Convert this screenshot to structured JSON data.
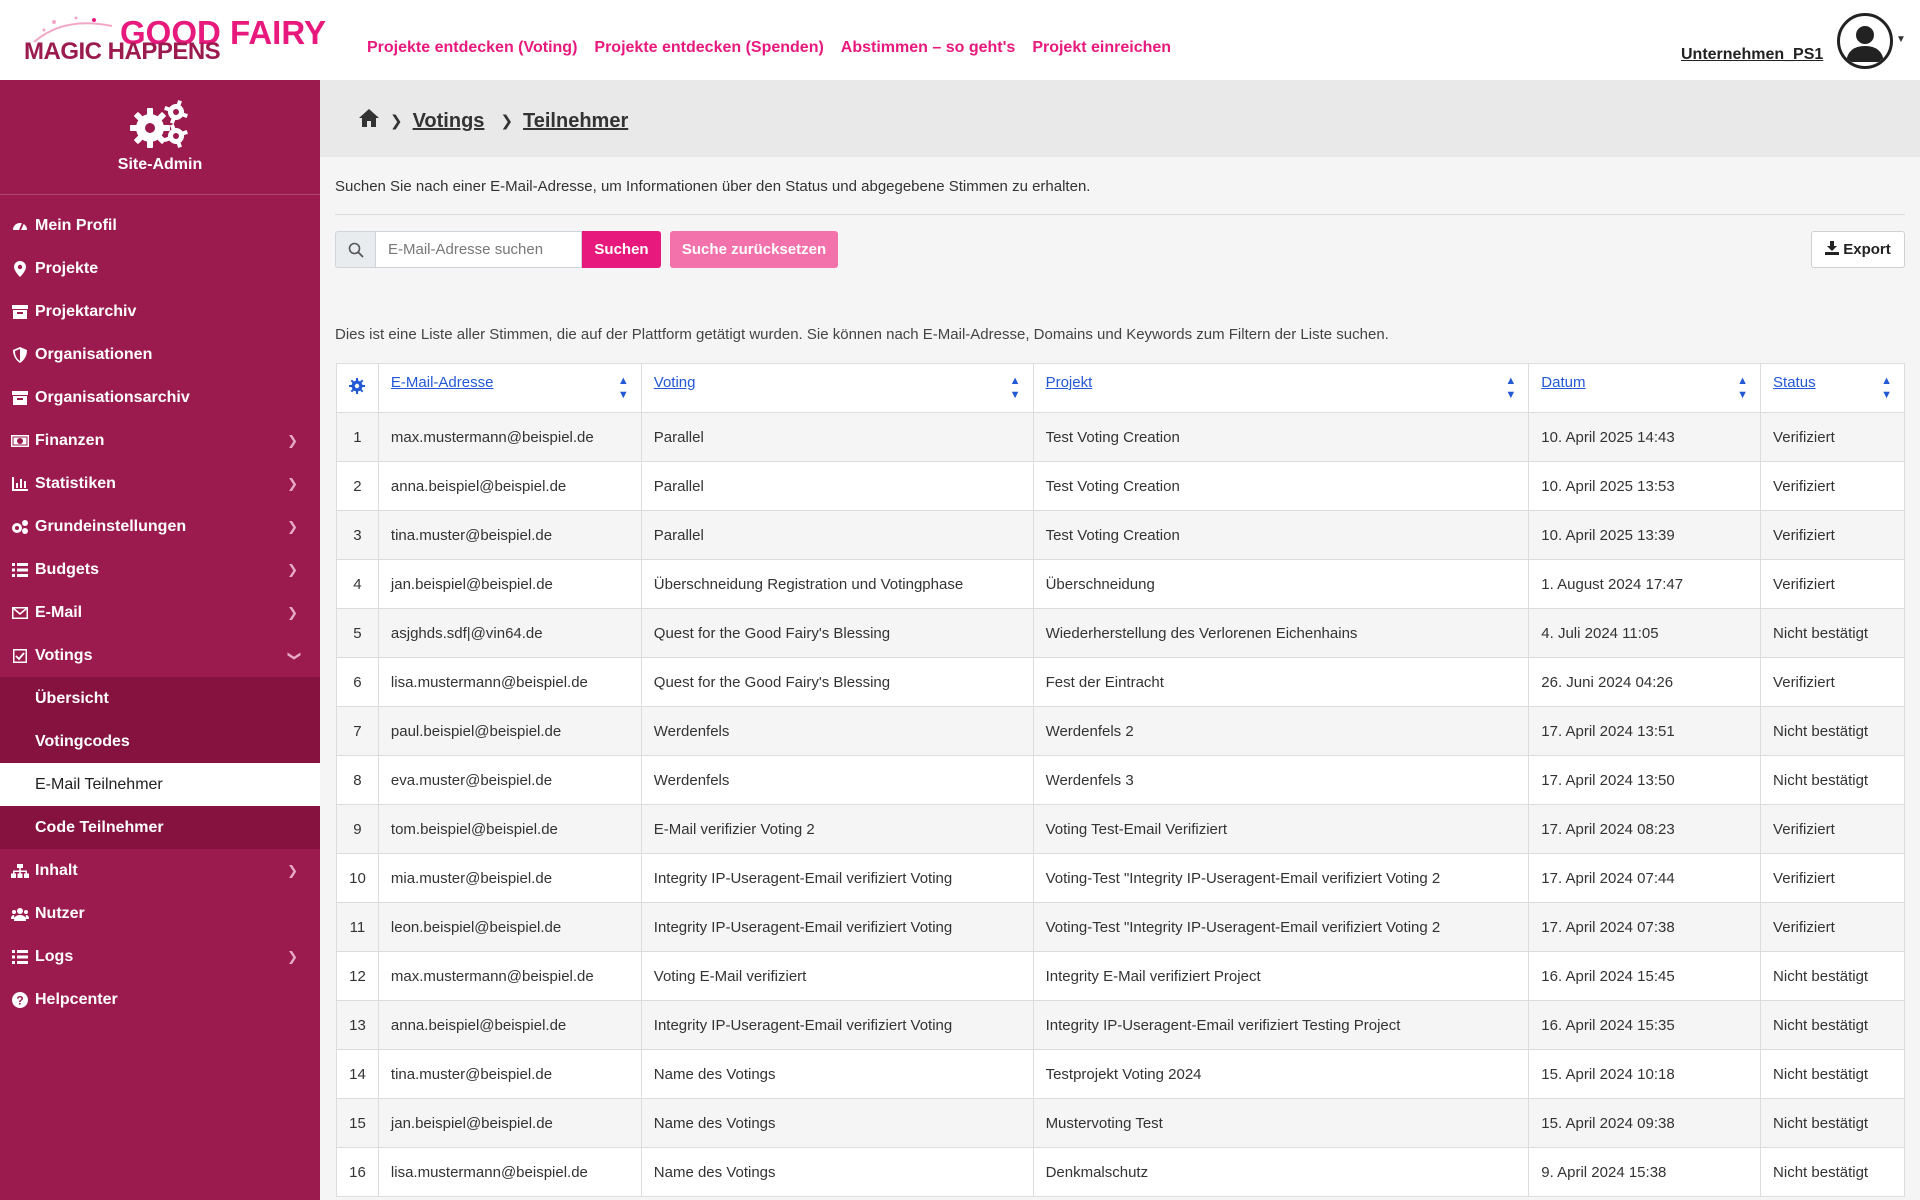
{
  "brand": {
    "line1": "GOOD FAIRY",
    "line2": "MAGIC HAPPENS",
    "primary_color": "#e8197d",
    "sidebar_color": "#9b1b4f"
  },
  "topnav": [
    {
      "label": "Projekte entdecken (Voting)"
    },
    {
      "label": "Projekte entdecken (Spenden)"
    },
    {
      "label": "Abstimmen – so geht's"
    },
    {
      "label": "Projekt einreichen"
    }
  ],
  "user": {
    "name": "Unternehmen_PS1",
    "avatar_icon": "user-circle-icon"
  },
  "sidebar": {
    "title": "Site-Admin",
    "items": [
      {
        "label": "Mein Profil",
        "icon": "gauge-icon"
      },
      {
        "label": "Projekte",
        "icon": "map-pin-icon"
      },
      {
        "label": "Projektarchiv",
        "icon": "archive-icon"
      },
      {
        "label": "Organisationen",
        "icon": "shield-icon"
      },
      {
        "label": "Organisationsarchiv",
        "icon": "archive-icon"
      },
      {
        "label": "Finanzen",
        "icon": "money-icon"
      },
      {
        "label": "Statistiken",
        "icon": "bar-chart-icon"
      },
      {
        "label": "Grundeinstellungen",
        "icon": "gears-icon"
      },
      {
        "label": "Budgets",
        "icon": "list-icon"
      },
      {
        "label": "E-Mail",
        "icon": "envelope-icon"
      },
      {
        "label": "Votings",
        "icon": "check-square-icon"
      }
    ],
    "votings_sub": [
      {
        "label": "Übersicht"
      },
      {
        "label": "Votingcodes"
      },
      {
        "label": "E-Mail Teilnehmer"
      },
      {
        "label": "Code Teilnehmer"
      }
    ],
    "items_after": [
      {
        "label": "Inhalt",
        "icon": "sitemap-icon"
      },
      {
        "label": "Nutzer",
        "icon": "users-icon"
      },
      {
        "label": "Logs",
        "icon": "list-icon"
      },
      {
        "label": "Helpcenter",
        "icon": "question-circle-icon"
      }
    ]
  },
  "breadcrumb": {
    "level1": "Votings",
    "level2": "Teilnehmer"
  },
  "intro_text": "Suchen Sie nach einer E-Mail-Adresse, um Informationen über den Status und abgegebene Stimmen zu erhalten.",
  "search": {
    "placeholder": "E-Mail-Adresse suchen",
    "submit_label": "Suchen",
    "reset_label": "Suche zurücksetzen",
    "export_label": "Export"
  },
  "list_info": "Dies ist eine Liste aller Stimmen, die auf der Plattform getätigt wurden. Sie können nach E-Mail-Adresse, Domains und Keywords zum Filtern der Liste suchen.",
  "table": {
    "columns": [
      "E-Mail-Adresse",
      "Voting",
      "Projekt",
      "Datum",
      "Status"
    ],
    "rows": [
      {
        "n": "1",
        "email": "max.mustermann@beispiel.de",
        "voting": "Parallel",
        "projekt": "Test Voting Creation",
        "datum": "10. April 2025 14:43",
        "status": "Verifiziert"
      },
      {
        "n": "2",
        "email": "anna.beispiel@beispiel.de",
        "voting": "Parallel",
        "projekt": "Test Voting Creation",
        "datum": "10. April 2025 13:53",
        "status": "Verifiziert"
      },
      {
        "n": "3",
        "email": "tina.muster@beispiel.de",
        "voting": "Parallel",
        "projekt": "Test Voting Creation",
        "datum": "10. April 2025 13:39",
        "status": "Verifiziert"
      },
      {
        "n": "4",
        "email": "jan.beispiel@beispiel.de",
        "voting": "Überschneidung Registration und Votingphase",
        "projekt": "Überschneidung",
        "datum": "1. August 2024 17:47",
        "status": "Verifiziert"
      },
      {
        "n": "5",
        "email": "asjghds.sdf|@vin64.de",
        "voting": "Quest for the Good Fairy's Blessing",
        "projekt": "Wiederherstellung des Verlorenen Eichenhains",
        "datum": "4. Juli 2024 11:05",
        "status": "Nicht bestätigt"
      },
      {
        "n": "6",
        "email": "lisa.mustermann@beispiel.de",
        "voting": "Quest for the Good Fairy's Blessing",
        "projekt": "Fest der Eintracht",
        "datum": "26. Juni 2024 04:26",
        "status": "Verifiziert"
      },
      {
        "n": "7",
        "email": "paul.beispiel@beispiel.de",
        "voting": "Werdenfels",
        "projekt": "Werdenfels 2",
        "datum": "17. April 2024 13:51",
        "status": "Nicht bestätigt"
      },
      {
        "n": "8",
        "email": "eva.muster@beispiel.de",
        "voting": "Werdenfels",
        "projekt": "Werdenfels 3",
        "datum": "17. April 2024 13:50",
        "status": "Nicht bestätigt"
      },
      {
        "n": "9",
        "email": "tom.beispiel@beispiel.de",
        "voting": "E-Mail verifizier Voting 2",
        "projekt": "Voting Test-Email Verifiziert",
        "datum": "17. April 2024 08:23",
        "status": "Verifiziert"
      },
      {
        "n": "10",
        "email": "mia.muster@beispiel.de",
        "voting": "Integrity IP-Useragent-Email verifiziert Voting",
        "projekt": "Voting-Test \"Integrity IP-Useragent-Email verifiziert Voting 2",
        "datum": "17. April 2024 07:44",
        "status": "Verifiziert"
      },
      {
        "n": "11",
        "email": "leon.beispiel@beispiel.de",
        "voting": "Integrity IP-Useragent-Email verifiziert Voting",
        "projekt": "Voting-Test \"Integrity IP-Useragent-Email verifiziert Voting 2",
        "datum": "17. April 2024 07:38",
        "status": "Verifiziert"
      },
      {
        "n": "12",
        "email": "max.mustermann@beispiel.de",
        "voting": "Voting E-Mail verifiziert",
        "projekt": "Integrity E-Mail verifiziert Project",
        "datum": "16. April 2024 15:45",
        "status": "Nicht bestätigt"
      },
      {
        "n": "13",
        "email": "anna.beispiel@beispiel.de",
        "voting": "Integrity IP-Useragent-Email verifiziert Voting",
        "projekt": "Integrity IP-Useragent-Email verifiziert Testing Project",
        "datum": "16. April 2024 15:35",
        "status": "Nicht bestätigt"
      },
      {
        "n": "14",
        "email": "tina.muster@beispiel.de",
        "voting": "Name des Votings",
        "projekt": "Testprojekt Voting 2024",
        "datum": "15. April 2024 10:18",
        "status": "Nicht bestätigt"
      },
      {
        "n": "15",
        "email": "jan.beispiel@beispiel.de",
        "voting": "Name des Votings",
        "projekt": "Mustervoting Test",
        "datum": "15. April 2024 09:38",
        "status": "Nicht bestätigt"
      },
      {
        "n": "16",
        "email": "lisa.mustermann@beispiel.de",
        "voting": "Name des Votings",
        "projekt": "Denkmalschutz",
        "datum": "9. April 2024 15:38",
        "status": "Nicht bestätigt"
      }
    ]
  }
}
